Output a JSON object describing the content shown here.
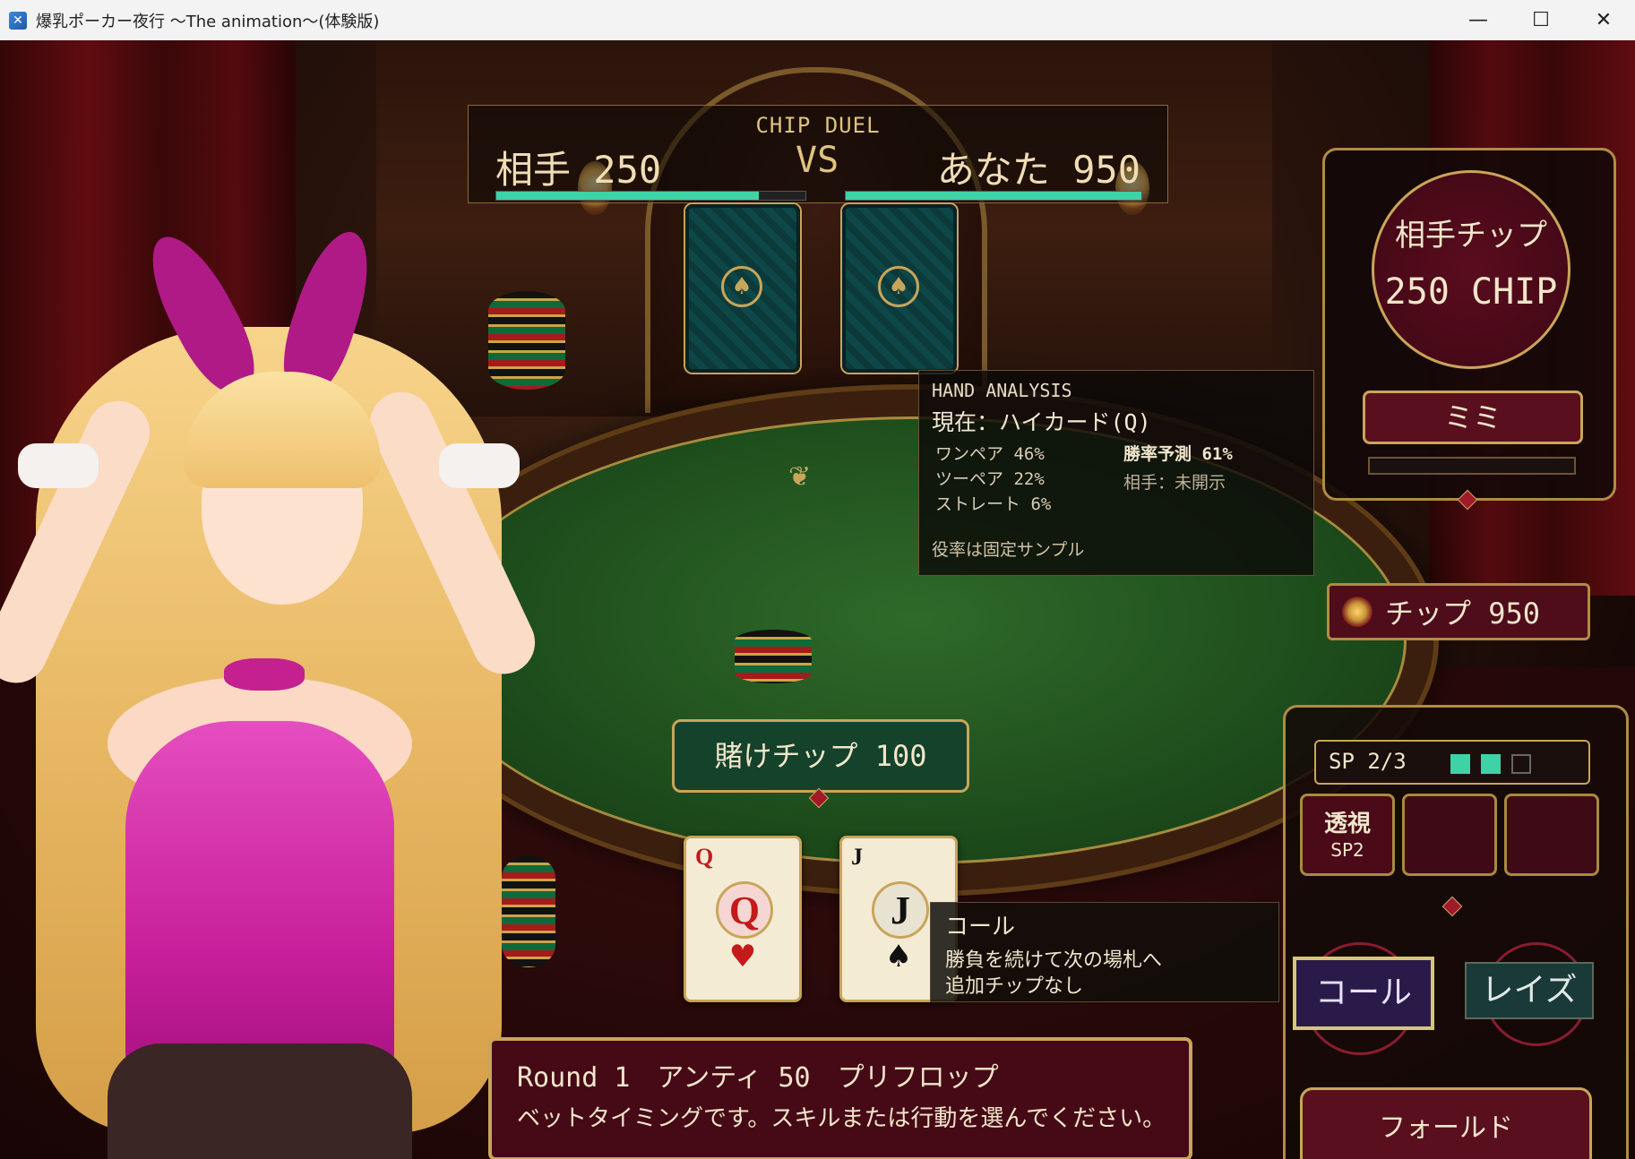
{
  "window": {
    "title": "爆乳ポーカー夜行 〜The animation〜(体験版)",
    "minimize": "—",
    "maximize": "☐",
    "close": "✕"
  },
  "duel": {
    "title": "CHIP DUEL",
    "opponent": "相手 250",
    "vs": "VS",
    "you": "あなた 950",
    "opponent_bar_fraction": 0.85,
    "you_bar_fraction": 1.0
  },
  "analysis": {
    "title": "HAND ANALYSIS",
    "current": "現在：ハイカード(Q)",
    "rows_left": [
      "ワンペア 46%",
      "ツーペア 22%",
      "ストレート 6%"
    ],
    "rows_right": [
      "勝率予測 61%",
      "相手：未開示"
    ],
    "footer": "役率は固定サンプル"
  },
  "opponent_panel": {
    "label": "相手チップ",
    "chips": "250 CHIP",
    "name": "ミミ"
  },
  "my_chips": "チップ 950",
  "bet": "賭けチップ 100",
  "player_cards": [
    {
      "rank": "Q",
      "suit": "♥",
      "color": "#c41a1a"
    },
    {
      "rank": "J",
      "suit": "♠",
      "color": "#111111"
    }
  ],
  "call_tooltip": {
    "title": "コール",
    "line1": "勝負を続けて次の場札へ",
    "line2": "追加チップなし"
  },
  "message": {
    "line1": "Round 1　アンティ 50　プリフロップ",
    "line2": "ベットタイミングです。スキルまたは行動を選んでください。"
  },
  "actions": {
    "sp": "SP 2/3",
    "sp_filled": 2,
    "sp_total": 3,
    "skill_name": "透視",
    "skill_cost": "SP2",
    "call": "コール",
    "raise": "レイズ",
    "fold": "フォールド"
  },
  "colors": {
    "accent_gold": "#c9a55a",
    "bar_teal": "#3ed3a6",
    "panel_maroon": "#4a0a18"
  }
}
